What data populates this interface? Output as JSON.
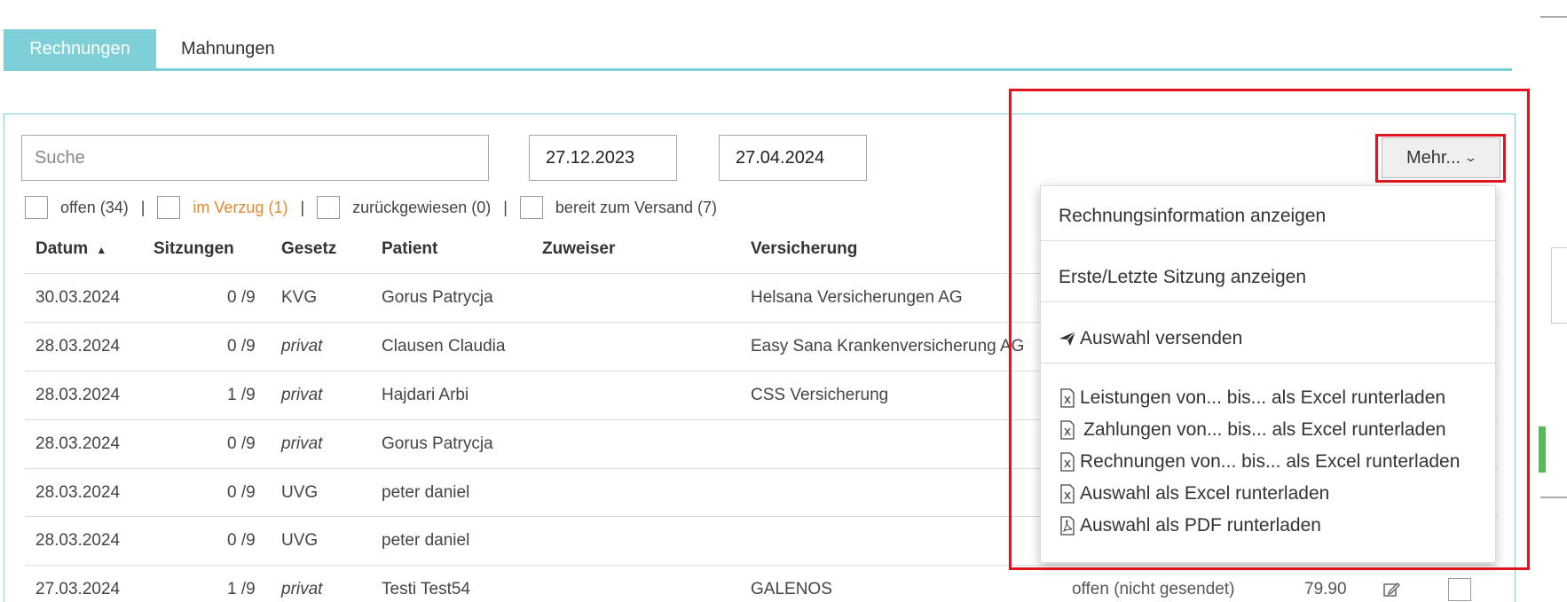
{
  "tabs": [
    {
      "label": "Rechnungen",
      "active": true
    },
    {
      "label": "Mahnungen",
      "active": false
    }
  ],
  "search": {
    "placeholder": "Suche",
    "value": ""
  },
  "date_from": "27.12.2023",
  "date_to": "27.04.2024",
  "more_button": {
    "label": "Mehr...",
    "icon": "chevron-down-icon"
  },
  "filters": [
    {
      "label": "offen (34)"
    },
    {
      "label": "im Verzug (1)",
      "color": "#e0892e"
    },
    {
      "label": "zurückgewiesen (0)"
    },
    {
      "label": "bereit zum Versand (7)"
    }
  ],
  "table": {
    "columns": [
      "Datum",
      "Sitzungen",
      "Gesetz",
      "Patient",
      "Zuweiser",
      "Versicherung"
    ],
    "sort_indicator": "▲",
    "rows": [
      {
        "datum": "30.03.2024",
        "sitzungen": "0 /9",
        "gesetz": "KVG",
        "patient": "Gorus Patrycja",
        "zuweiser": "",
        "versicherung": "Helsana Versicherungen AG",
        "status": "",
        "betrag": ""
      },
      {
        "datum": "28.03.2024",
        "sitzungen": "0 /9",
        "gesetz": "privat",
        "patient": "Clausen Claudia",
        "zuweiser": "",
        "versicherung": "Easy Sana Krankenversicherung AG",
        "status": "",
        "betrag": ""
      },
      {
        "datum": "28.03.2024",
        "sitzungen": "1 /9",
        "gesetz": "privat",
        "patient": "Hajdari Arbi",
        "zuweiser": "",
        "versicherung": "CSS Versicherung",
        "status": "",
        "betrag": ""
      },
      {
        "datum": "28.03.2024",
        "sitzungen": "0 /9",
        "gesetz": "privat",
        "patient": "Gorus Patrycja",
        "zuweiser": "",
        "versicherung": "",
        "status": "",
        "betrag": ""
      },
      {
        "datum": "28.03.2024",
        "sitzungen": "0 /9",
        "gesetz": "UVG",
        "patient": "peter daniel",
        "zuweiser": "",
        "versicherung": "",
        "status": "",
        "betrag": ""
      },
      {
        "datum": "28.03.2024",
        "sitzungen": "0 /9",
        "gesetz": "UVG",
        "patient": "peter daniel",
        "zuweiser": "",
        "versicherung": "",
        "status": "",
        "betrag": ""
      },
      {
        "datum": "27.03.2024",
        "sitzungen": "1 /9",
        "gesetz": "privat",
        "patient": "Testi Test54",
        "zuweiser": "",
        "versicherung": "GALENOS",
        "status": "offen (nicht gesendet)",
        "betrag": "79.90"
      }
    ]
  },
  "dropdown": {
    "items": [
      {
        "label": "Rechnungsinformation anzeigen",
        "icon": ""
      },
      {
        "label": "Erste/Letzte Sitzung anzeigen",
        "icon": ""
      },
      {
        "label": "Auswahl versenden",
        "icon": "send-icon"
      },
      {
        "label": "Leistungen von... bis... als Excel runterladen",
        "icon": "excel-file-icon"
      },
      {
        "label": "Zahlungen von... bis... als Excel runterladen",
        "icon": "excel-file-icon"
      },
      {
        "label": "Rechnungen von... bis... als Excel runterladen",
        "icon": "excel-file-icon"
      },
      {
        "label": "Auswahl als Excel runterladen",
        "icon": "excel-file-icon"
      },
      {
        "label": "Auswahl als PDF runterladen",
        "icon": "pdf-file-icon"
      }
    ]
  },
  "colors": {
    "accent": "#7ecfd8",
    "highlight": "#e0141e",
    "overdue": "#e0892e"
  }
}
